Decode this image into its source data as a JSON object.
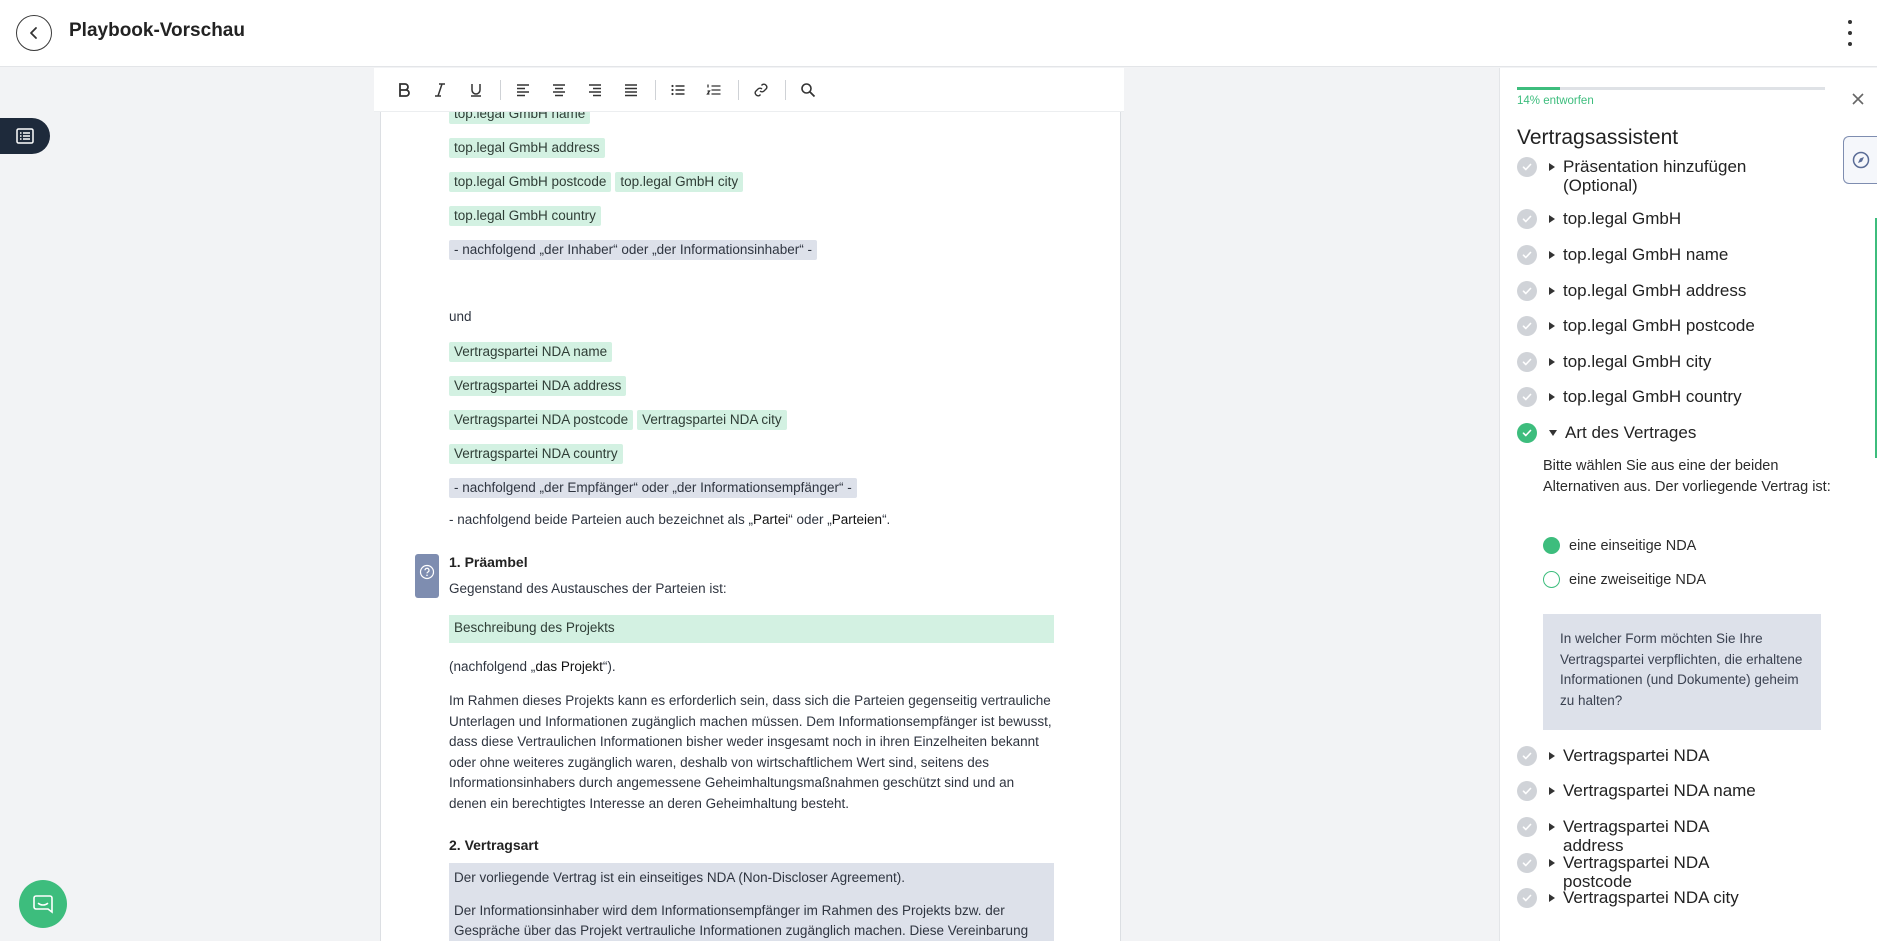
{
  "header": {
    "title": "Playbook-Vorschau",
    "back_icon": "arrow-left-icon",
    "menu_icon": "kebab-menu-icon"
  },
  "toolbar": [
    "bold",
    "italic",
    "underline",
    "align-left",
    "align-center",
    "align-right",
    "align-justify",
    "bullet-list",
    "numbered-list",
    "link",
    "search"
  ],
  "document": {
    "owner_name": "top.legal GmbH name",
    "owner_address": "top.legal GmbH address",
    "owner_postcode": "top.legal GmbH postcode",
    "owner_city": "top.legal GmbH city",
    "owner_country": "top.legal GmbH country",
    "owner_alias": "- nachfolgend „der Inhaber“ oder „der Informationsinhaber“ -",
    "and": "und",
    "party_name": "Vertragspartei NDA name",
    "party_address": "Vertragspartei NDA address",
    "party_postcode": "Vertragspartei NDA postcode",
    "party_city": "Vertragspartei NDA city",
    "party_country": "Vertragspartei NDA country",
    "party_alias": "- nachfolgend „der Empfänger“ oder „der Informationsempfänger“ -",
    "both_prefix": "- nachfolgend beide Parteien auch bezeichnet als „",
    "both_partei": "Partei",
    "both_mid": "“ oder „",
    "both_parteien": "Parteien",
    "both_suffix": "“.",
    "section1_title": "1. Präambel",
    "section1_intro": "Gegenstand des Austausches der Parteien ist:",
    "project_description": "Beschreibung des Projekts",
    "project_prefix": "(nachfolgend „",
    "project_term": "das Projekt",
    "project_suffix": "“).",
    "section1_body": "Im Rahmen dieses Projekts kann es erforderlich sein, dass sich die Parteien gegenseitig vertrauliche Unterlagen und Informationen zugänglich machen müssen. Dem Informationsempfänger ist bewusst, dass diese Vertraulichen Informationen bisher weder insgesamt noch in ihren Einzelheiten bekannt oder ohne weiteres zugänglich waren, deshalb von wirtschaftlichem Wert sind, seitens des Informationsinhabers durch angemessene Geheimhaltungsmaßnahmen geschützt sind und an denen ein berechtigtes Interesse an deren Geheimhaltung besteht.",
    "section2_title": "2. Vertragsart",
    "section2_line1": "Der vorliegende Vertrag ist ein einseitiges NDA (Non-Discloser Agreement).",
    "section2_line2": "Der Informationsinhaber wird dem Informationsempfänger im Rahmen des Projekts bzw. der Gespräche über das Projekt vertrauliche Informationen zugänglich machen. Diese Vereinbarung legt"
  },
  "panel": {
    "progress_label": "14% entworfen",
    "progress_percent": 14,
    "title": "Vertragsassistent",
    "steps_top": [
      {
        "label": "Präsentation hinzufügen (Optional)",
        "done": false
      },
      {
        "label": "top.legal GmbH",
        "done": false
      },
      {
        "label": "top.legal GmbH name",
        "done": false
      },
      {
        "label": "top.legal GmbH address",
        "done": false
      },
      {
        "label": "top.legal GmbH postcode",
        "done": false
      },
      {
        "label": "top.legal GmbH city",
        "done": false
      },
      {
        "label": "top.legal GmbH country",
        "done": false
      },
      {
        "label": "Art des Vertrages",
        "done": true
      }
    ],
    "art_description": "Bitte wählen Sie aus eine der beiden Alternativen aus. Der vorliegende Vertrag ist:",
    "option_one": "eine einseitige NDA",
    "option_two": "eine zweiseitige NDA",
    "selected_option": "eine einseitige NDA",
    "hint": "In welcher Form möchten Sie Ihre Vertragspartei verpflichten, die erhaltene Informationen (und Dokumente) geheim zu halten?",
    "steps_bottom": [
      {
        "label": "Vertragspartei NDA",
        "done": false
      },
      {
        "label": "Vertragspartei NDA name",
        "done": false
      },
      {
        "label": "Vertragspartei NDA address",
        "done": false
      },
      {
        "label": "Vertragspartei NDA postcode",
        "done": false
      },
      {
        "label": "Vertragspartei NDA city",
        "done": false
      }
    ]
  },
  "colors": {
    "accent": "#3dbd7d",
    "navy": "#1e2a3b",
    "variable_bg": "#d3f1e2",
    "block_bg": "#dde1ea"
  }
}
